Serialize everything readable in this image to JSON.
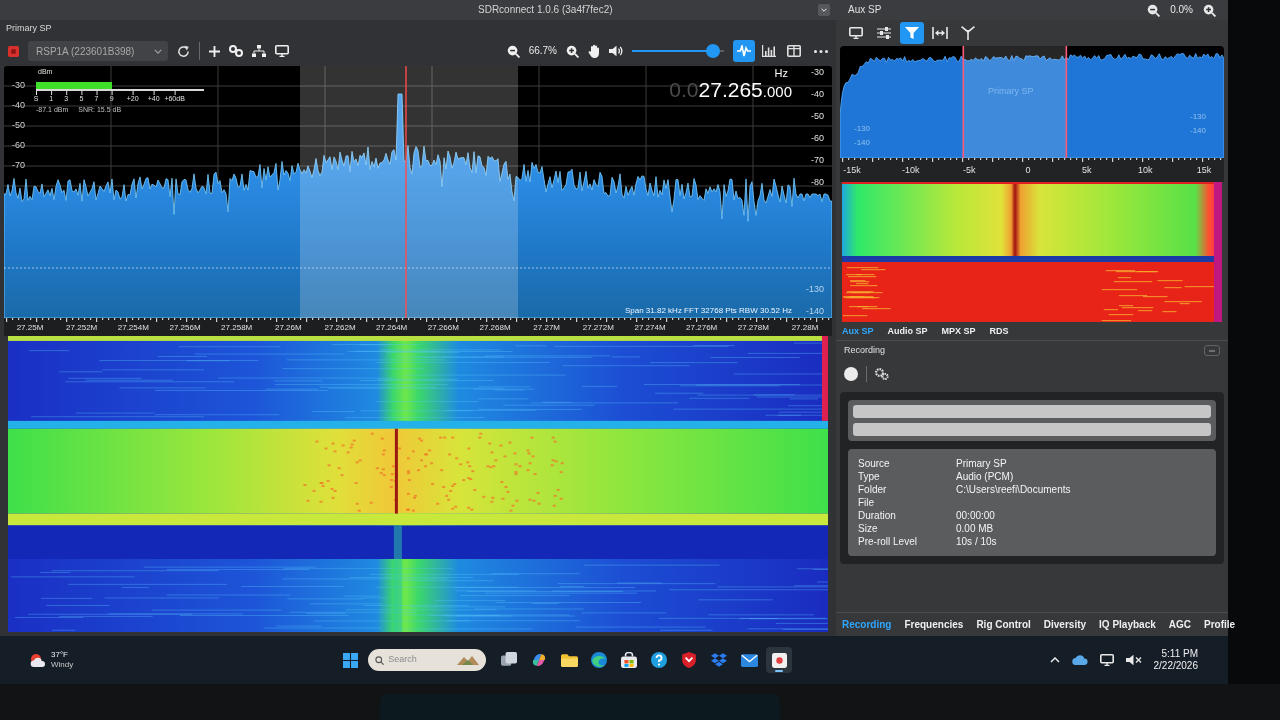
{
  "window": {
    "title": "SDRconnect 1.0.6 (3a4f7fec2)"
  },
  "primary": {
    "label": "Primary SP",
    "toolbar": {
      "device": "RSP1A (223601B398)",
      "zoom": "66.7%",
      "volume": {
        "level": 0.95
      },
      "views": [
        {
          "kind": "spectrum",
          "selected": true
        },
        {
          "kind": "bars",
          "selected": false
        },
        {
          "kind": "split",
          "selected": false
        }
      ]
    },
    "spectrum": {
      "unit": "dBm",
      "meter": {
        "level": 0.45,
        "scale": [
          "S",
          "1",
          "3",
          "5",
          "7",
          "9",
          "+20",
          "+40",
          "+60dB"
        ],
        "power": "-87.1 dBm",
        "snr": "SNR: 15.5 dB"
      },
      "frequency": {
        "prefix": "0.0",
        "main": "27.265",
        "fraction": ".000",
        "unit": "Hz"
      },
      "left_axis": [
        "-30",
        "-40",
        "-50",
        "-60",
        "-70"
      ],
      "right_axis": {
        "upper": [
          "-30",
          "-40",
          "-50",
          "-60",
          "-70",
          "-80"
        ],
        "lower": [
          "-130",
          "-140"
        ]
      },
      "span": "Span 31.82 kHz FFT 32768 Pts RBW 30.52 Hz"
    },
    "frequency_axis": [
      "27.25M",
      "27.252M",
      "27.254M",
      "27.256M",
      "27.258M",
      "27.26M",
      "27.262M",
      "27.264M",
      "27.266M",
      "27.268M",
      "27.27M",
      "27.272M",
      "27.274M",
      "27.276M",
      "27.278M",
      "27.28M"
    ]
  },
  "aux": {
    "label": "Aux SP",
    "zoom": "0.0%",
    "tools": [
      {
        "kind": "display",
        "selected": false
      },
      {
        "kind": "sliders",
        "selected": false
      },
      {
        "kind": "filter",
        "selected": true
      },
      {
        "kind": "span",
        "selected": false
      },
      {
        "kind": "antenna",
        "selected": false
      }
    ],
    "spectrum": {
      "passband_label": "Primary SP",
      "left_axis": [
        "-130",
        "-140"
      ],
      "right_axis": [
        "-130",
        "-140"
      ]
    },
    "axis": [
      "-15k",
      "-10k",
      "-5k",
      "0",
      "5k",
      "10k",
      "15k"
    ],
    "tabs": [
      {
        "label": "Aux SP",
        "selected": true
      },
      {
        "label": "Audio SP",
        "selected": false
      },
      {
        "label": "MPX SP",
        "selected": false
      },
      {
        "label": "RDS",
        "selected": false
      }
    ]
  },
  "recording": {
    "title": "Recording",
    "fields": [
      {
        "label": "Source",
        "value": "Primary SP"
      },
      {
        "label": "Type",
        "value": "Audio (PCM)"
      },
      {
        "label": "Folder",
        "value": "C:\\Users\\reefi\\Documents"
      },
      {
        "label": "File"
      },
      {
        "label": "Duration",
        "value": "00:00:00"
      },
      {
        "label": "Size",
        "value": "0.00 MB"
      },
      {
        "label": "Pre-roll Level",
        "value": "10s / 10s"
      }
    ]
  },
  "panel_tabs": [
    {
      "label": "Recording",
      "selected": true
    },
    {
      "label": "Frequencies",
      "selected": false
    },
    {
      "label": "Rig Control",
      "selected": false
    },
    {
      "label": "Diversity",
      "selected": false
    },
    {
      "label": "IQ Playback",
      "selected": false
    },
    {
      "label": "AGC",
      "selected": false
    },
    {
      "label": "Profile",
      "selected": false
    }
  ],
  "taskbar": {
    "weather": {
      "temperature": "37°F",
      "condition": "Windy"
    },
    "search": {
      "placeholder": "Search"
    },
    "apps": [
      {
        "kind": "taskview",
        "open": false
      },
      {
        "kind": "assistant",
        "open": false
      },
      {
        "kind": "explorer",
        "open": false
      },
      {
        "kind": "browser",
        "open": false
      },
      {
        "kind": "store",
        "open": false
      },
      {
        "kind": "help",
        "open": false
      },
      {
        "kind": "security",
        "open": false
      },
      {
        "kind": "cloudbox",
        "open": false
      },
      {
        "kind": "mail",
        "open": false
      },
      {
        "kind": "sdr",
        "open": true
      }
    ],
    "clock": {
      "time": "5:11 PM",
      "date": "2/22/2026"
    }
  }
}
